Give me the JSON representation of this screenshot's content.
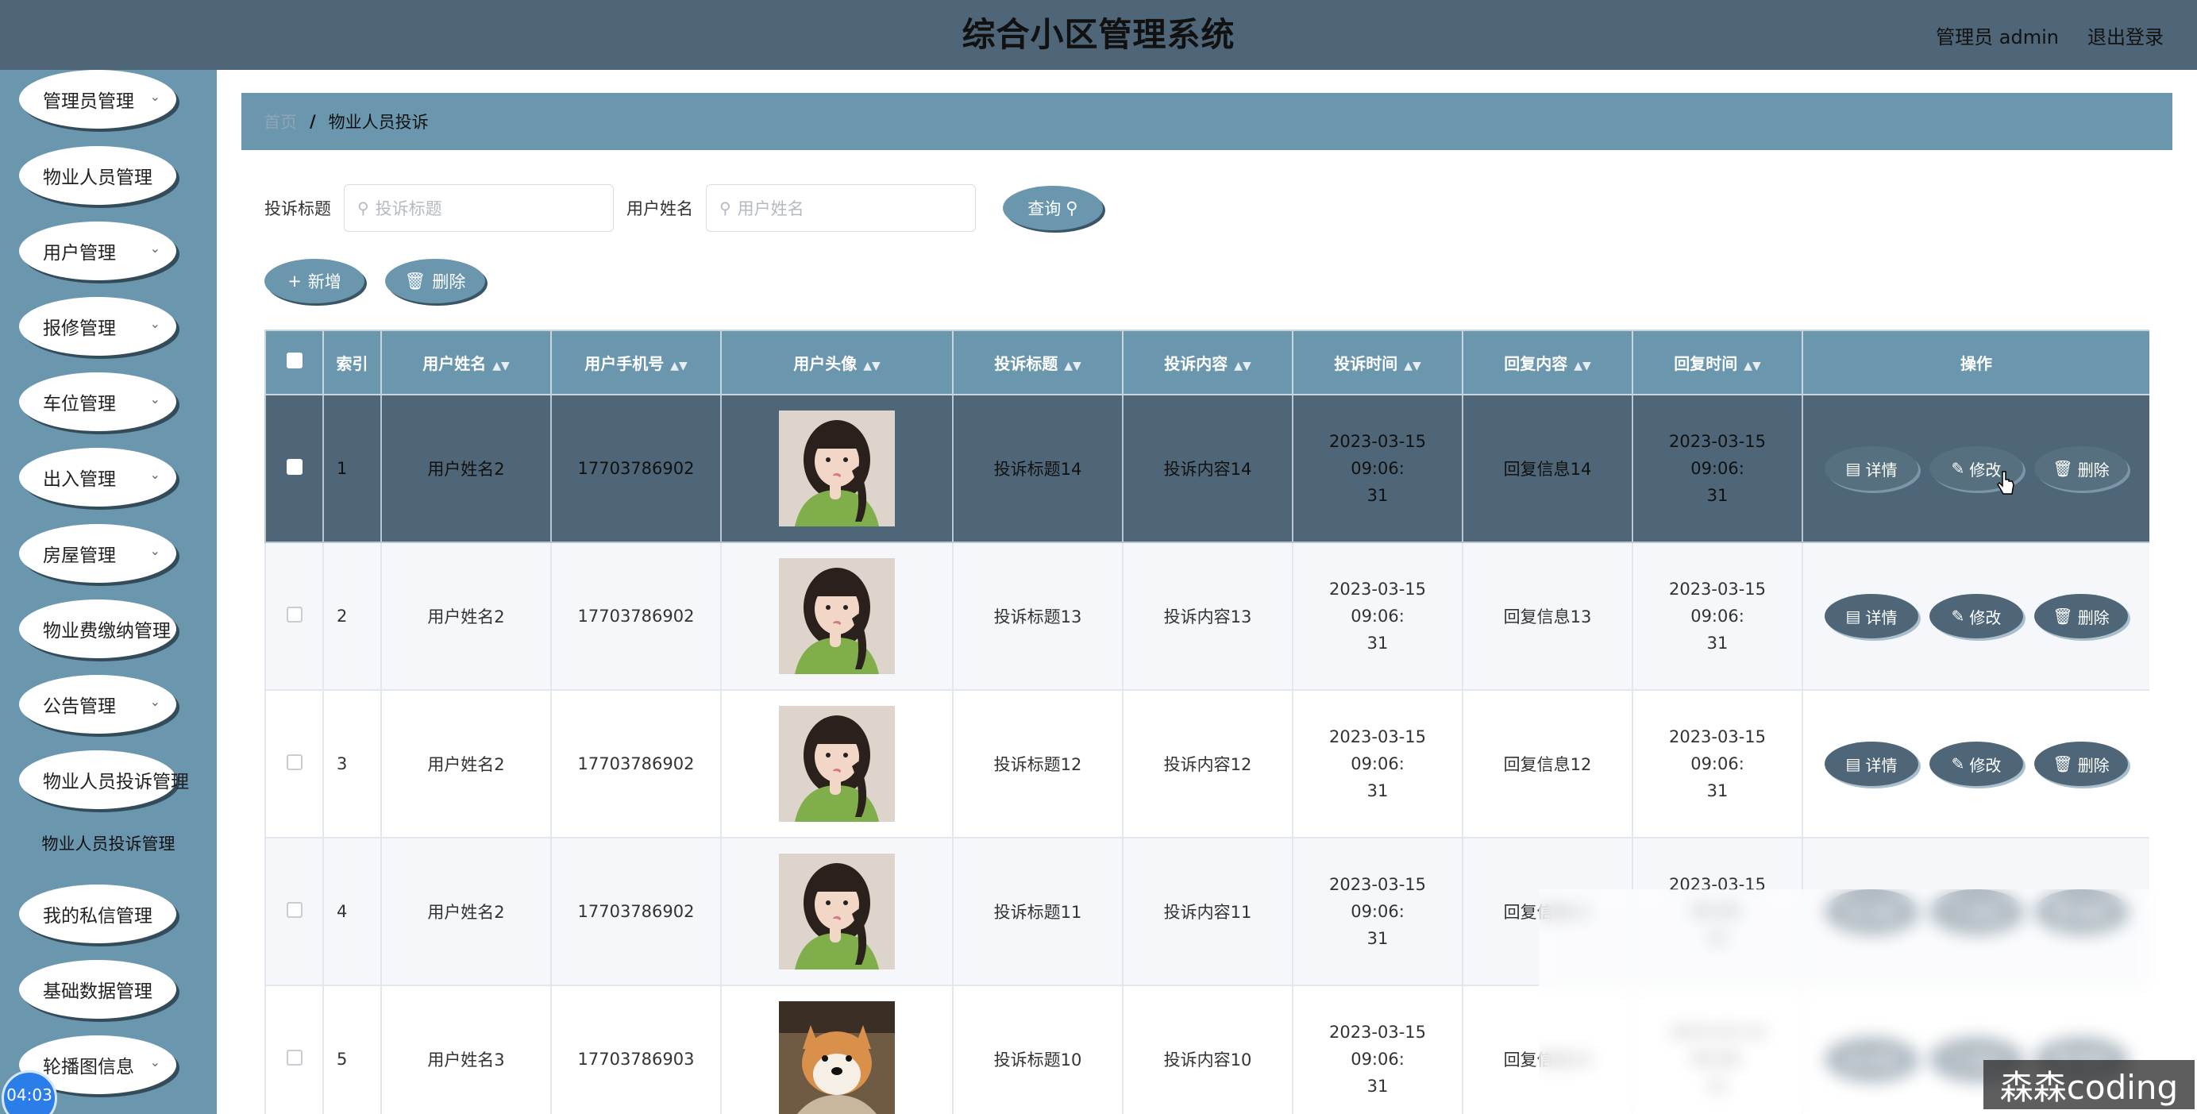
{
  "header": {
    "title": "综合小区管理系统",
    "user_label": "管理员 admin",
    "logout_label": "退出登录"
  },
  "sidebar": {
    "items": [
      {
        "label": "管理员管理",
        "has_arrow": true
      },
      {
        "label": "物业人员管理",
        "has_arrow": false
      },
      {
        "label": "用户管理",
        "has_arrow": true
      },
      {
        "label": "报修管理",
        "has_arrow": true
      },
      {
        "label": "车位管理",
        "has_arrow": true
      },
      {
        "label": "出入管理",
        "has_arrow": true
      },
      {
        "label": "房屋管理",
        "has_arrow": true
      },
      {
        "label": "物业费缴纳管理",
        "has_arrow": false
      },
      {
        "label": "公告管理",
        "has_arrow": true
      },
      {
        "label": "物业人员投诉管理",
        "has_arrow": false
      },
      {
        "label": "我的私信管理",
        "has_arrow": false
      },
      {
        "label": "基础数据管理",
        "has_arrow": false
      },
      {
        "label": "轮播图信息",
        "has_arrow": true
      }
    ],
    "submenu_active": "物业人员投诉管理",
    "timer": "04:03"
  },
  "breadcrumb": {
    "home": "首页",
    "separator": "/",
    "current": "物业人员投诉"
  },
  "search": {
    "title_label": "投诉标题",
    "title_placeholder": "投诉标题",
    "name_label": "用户姓名",
    "name_placeholder": "用户姓名",
    "query_label": "查询"
  },
  "actions": {
    "add_label": "新增",
    "delete_label": "删除"
  },
  "table": {
    "columns": [
      "索引",
      "用户姓名",
      "用户手机号",
      "用户头像",
      "投诉标题",
      "投诉内容",
      "投诉时间",
      "回复内容",
      "回复时间",
      "操作"
    ],
    "rows": [
      {
        "index": "1",
        "name": "用户姓名2",
        "phone": "17703786902",
        "avatar": "girl",
        "title": "投诉标题14",
        "content": "投诉内容14",
        "time": "2023-03-15 09:06:\n31",
        "reply": "回复信息14",
        "reply_time": "2023-03-15 09:06:\n31"
      },
      {
        "index": "2",
        "name": "用户姓名2",
        "phone": "17703786902",
        "avatar": "girl",
        "title": "投诉标题13",
        "content": "投诉内容13",
        "time": "2023-03-15 09:06:\n31",
        "reply": "回复信息13",
        "reply_time": "2023-03-15 09:06:\n31"
      },
      {
        "index": "3",
        "name": "用户姓名2",
        "phone": "17703786902",
        "avatar": "girl",
        "title": "投诉标题12",
        "content": "投诉内容12",
        "time": "2023-03-15 09:06:\n31",
        "reply": "回复信息12",
        "reply_time": "2023-03-15 09:06:\n31"
      },
      {
        "index": "4",
        "name": "用户姓名2",
        "phone": "17703786902",
        "avatar": "girl",
        "title": "投诉标题11",
        "content": "投诉内容11",
        "time": "2023-03-15 09:06:\n31",
        "reply": "回复信息11",
        "reply_time": "2023-03-15 09:06:\n31"
      },
      {
        "index": "5",
        "name": "用户姓名3",
        "phone": "17703786903",
        "avatar": "dog",
        "title": "投诉标题10",
        "content": "投诉内容10",
        "time": "2023-03-15 09:06:\n31",
        "reply": "回复信息10",
        "reply_time": "2023-03-15 09:06:\n31"
      }
    ],
    "op_detail": "详情",
    "op_edit": "修改",
    "op_delete": "删除"
  },
  "watermark": "森森coding",
  "colors": {
    "header_bg": "#4e6677",
    "sidebar_bg": "#6a96ae",
    "accent": "#6a96ae",
    "selected_row": "#4e6677"
  }
}
